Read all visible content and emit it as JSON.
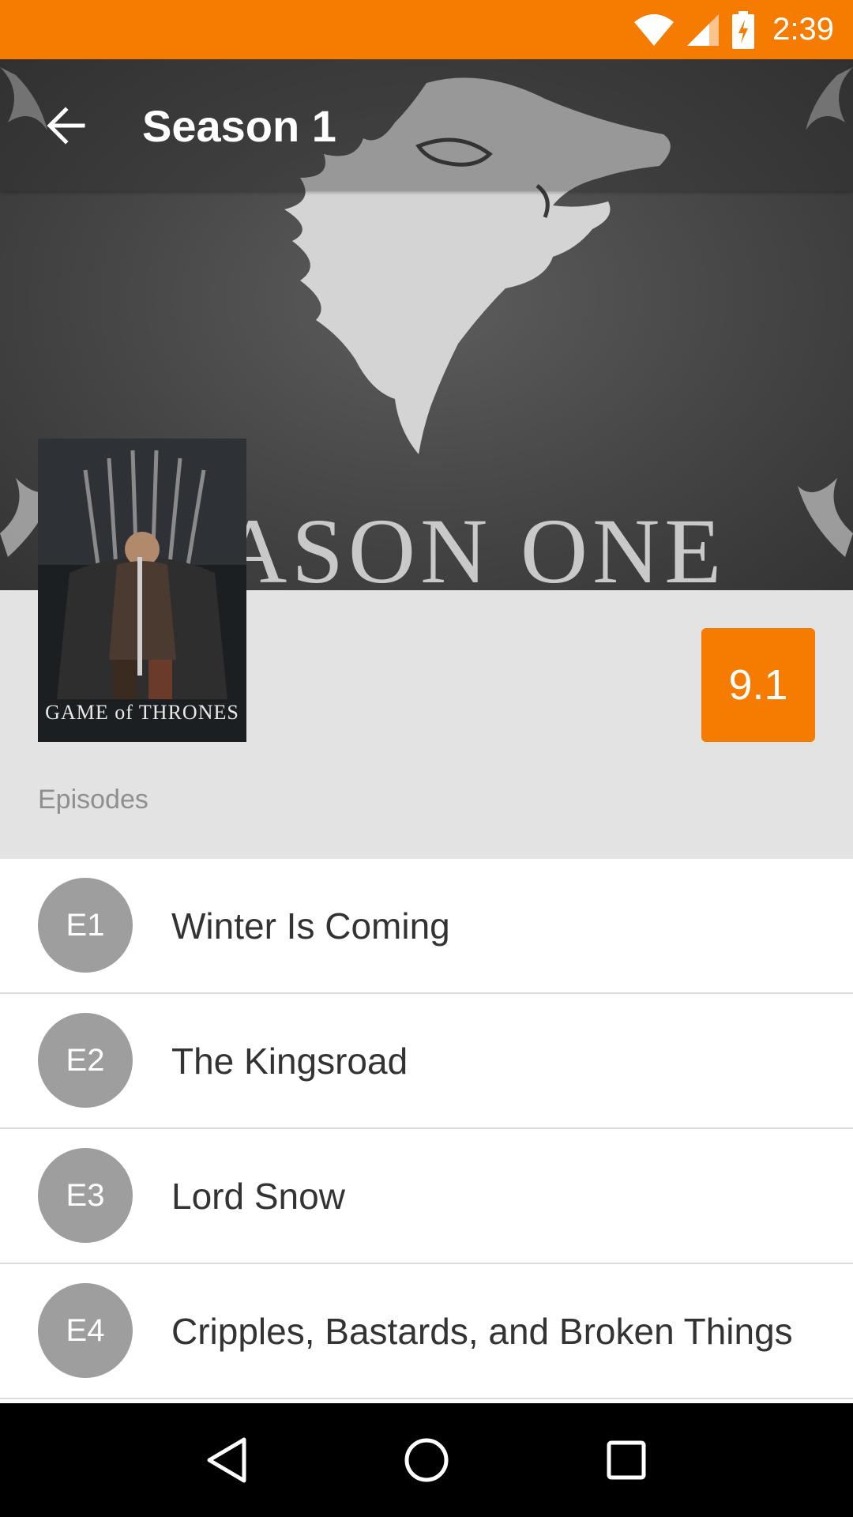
{
  "status_bar": {
    "time": "2:39",
    "color": "#f57c00"
  },
  "toolbar": {
    "title": "Season 1",
    "back_icon": "arrow-back-icon"
  },
  "hero": {
    "caption": "EASON ONE"
  },
  "poster": {
    "logo_text": "GAME of THRONES"
  },
  "rating": {
    "value": "9.1",
    "color": "#f57c00"
  },
  "episodes_section": {
    "label": "Episodes"
  },
  "episodes": [
    {
      "badge": "E1",
      "title": "Winter Is Coming"
    },
    {
      "badge": "E2",
      "title": "The Kingsroad"
    },
    {
      "badge": "E3",
      "title": "Lord Snow"
    },
    {
      "badge": "E4",
      "title": "Cripples, Bastards, and Broken Things"
    }
  ],
  "nav_bar": {
    "icons": [
      "back-triangle-icon",
      "home-circle-icon",
      "recents-square-icon"
    ]
  }
}
